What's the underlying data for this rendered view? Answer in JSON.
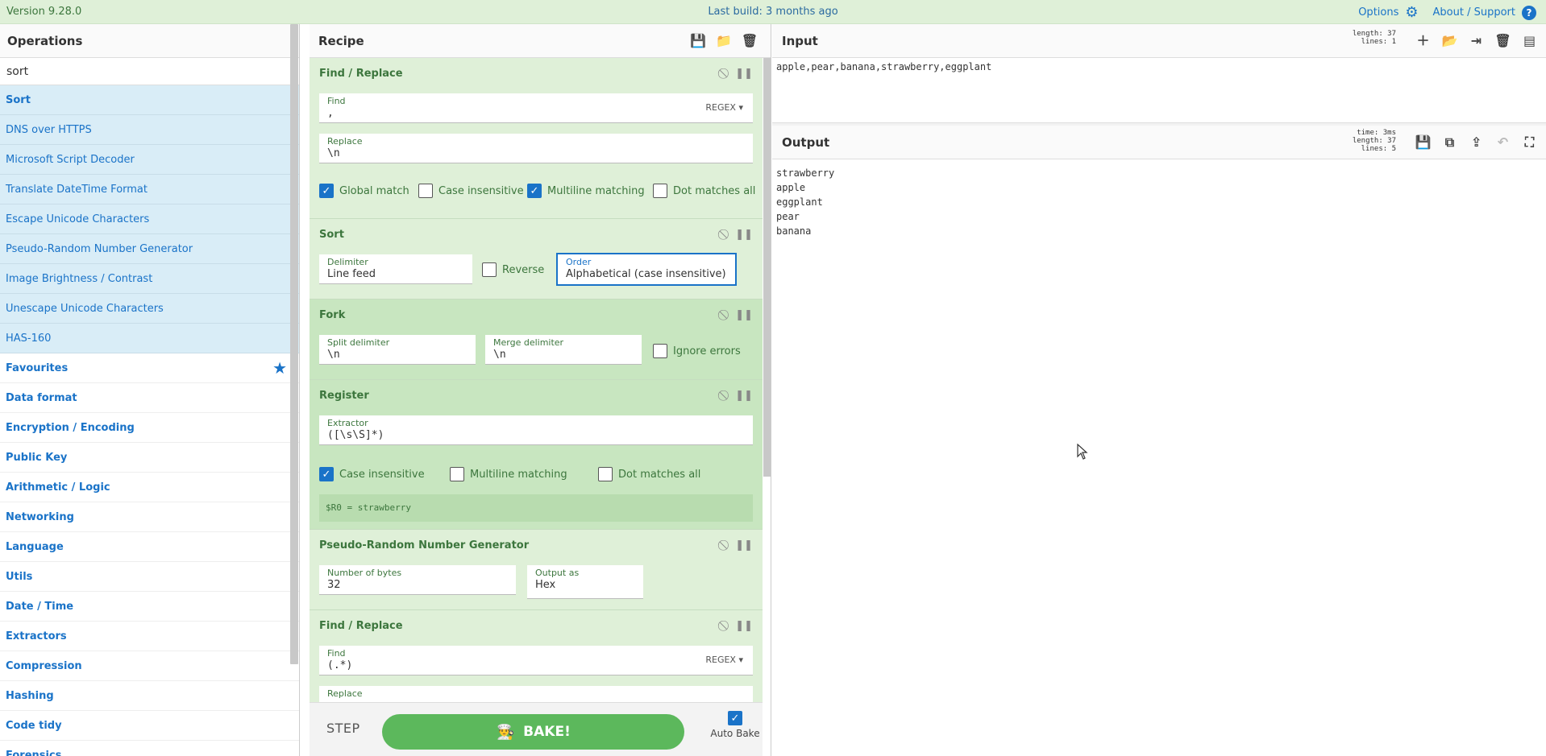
{
  "banner": {
    "version": "Version 9.28.0",
    "last_build": "Last build: 3 months ago",
    "options_label": "Options",
    "about_label": "About / Support"
  },
  "operations": {
    "title": "Operations",
    "search_value": "sort",
    "results": [
      "Sort",
      "DNS over HTTPS",
      "Microsoft Script Decoder",
      "Translate DateTime Format",
      "Escape Unicode Characters",
      "Pseudo-Random Number Generator",
      "Image Brightness / Contrast",
      "Unescape Unicode Characters",
      "HAS-160"
    ],
    "categories": [
      "Favourites",
      "Data format",
      "Encryption / Encoding",
      "Public Key",
      "Arithmetic / Logic",
      "Networking",
      "Language",
      "Utils",
      "Date / Time",
      "Extractors",
      "Compression",
      "Hashing",
      "Code tidy",
      "Forensics"
    ]
  },
  "recipe": {
    "title": "Recipe",
    "find_replace_1": {
      "title": "Find / Replace",
      "find_label": "Find",
      "find_value": ",",
      "find_mode": "REGEX",
      "replace_label": "Replace",
      "replace_value": "\\n",
      "global_match": "Global match",
      "case_insensitive": "Case insensitive",
      "multiline": "Multiline matching",
      "dot_all": "Dot matches all"
    },
    "sort": {
      "title": "Sort",
      "delimiter_label": "Delimiter",
      "delimiter_value": "Line feed",
      "reverse": "Reverse",
      "order_label": "Order",
      "order_value": "Alphabetical (case insensitive)"
    },
    "fork": {
      "title": "Fork",
      "split_label": "Split delimiter",
      "split_value": "\\n",
      "merge_label": "Merge delimiter",
      "merge_value": "\\n",
      "ignore_errors": "Ignore errors"
    },
    "register": {
      "title": "Register",
      "extractor_label": "Extractor",
      "extractor_value": "([\\s\\S]*)",
      "case_insensitive": "Case insensitive",
      "multiline": "Multiline matching",
      "dot_all": "Dot matches all",
      "output": "$R0 = strawberry"
    },
    "prng": {
      "title": "Pseudo-Random Number Generator",
      "bytes_label": "Number of bytes",
      "bytes_value": "32",
      "output_label": "Output as",
      "output_value": "Hex"
    },
    "find_replace_2": {
      "title": "Find / Replace",
      "find_label": "Find",
      "find_value": "(.*)",
      "find_mode": "REGEX",
      "replace_label": "Replace"
    },
    "step_label": "STEP",
    "bake_label": "BAKE!",
    "auto_bake_label": "Auto Bake"
  },
  "input": {
    "title": "Input",
    "stats_length": "length: 37",
    "stats_lines": "lines:  1",
    "text": "apple,pear,banana,strawberry,eggplant"
  },
  "output": {
    "title": "Output",
    "stats_time": "time:  3ms",
    "stats_length": "length:  37",
    "stats_lines": "lines:   5",
    "lines": [
      "strawberry",
      "apple",
      "eggplant",
      "pear",
      "banana"
    ]
  },
  "colors": {
    "accent": "#1a73c8",
    "recipe_bg": "#dff0d8",
    "bake": "#5cb85c",
    "highlight": "#d9edf7"
  }
}
